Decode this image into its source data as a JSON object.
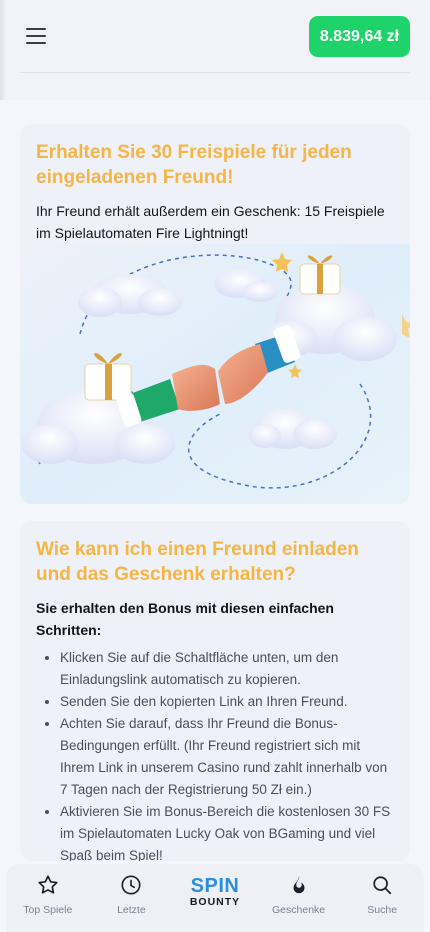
{
  "header": {
    "balance": "8.839,64 zł"
  },
  "invite_card": {
    "title": "Erhalten Sie 30 Freispiele für jeden eingeladenen Freund!",
    "subtitle": "Ihr Freund erhält außerdem ein Geschenk: 15 Freispiele im Spielautomaten Fire Lightningt!"
  },
  "howto_card": {
    "title": "Wie kann ich einen Freund einladen und das Geschenk erhalten?",
    "lead": "Sie erhalten den Bonus mit diesen einfachen Schritten:",
    "steps": [
      "Klicken Sie auf die Schaltfläche unten, um den Einladungslink automatisch zu kopieren.",
      "Senden Sie den kopierten Link an Ihren Freund.",
      "Achten Sie darauf, dass Ihr Freund die Bonus-Bedingungen erfüllt. (Ihr Freund registriert sich mit Ihrem Link in unserem Casino rund zahlt innerhalb von 7 Tagen nach der Registrierung 50 Zł ein.)",
      "Aktivieren Sie im Bonus-Bereich die kostenlosen 30 FS im Spielautomaten Lucky Oak von BGaming und viel Spaß beim Spiel!"
    ]
  },
  "bottom_nav": {
    "items": [
      {
        "label": "Top Spiele",
        "icon": "star-icon"
      },
      {
        "label": "Letzte",
        "icon": "clock-icon"
      },
      {
        "label": "",
        "icon": "spin-bounty-logo"
      },
      {
        "label": "Geschenke",
        "icon": "fire-icon"
      },
      {
        "label": "Suche",
        "icon": "search-icon"
      }
    ],
    "logo_top": "SPIN",
    "logo_bottom": "BOUNTY"
  },
  "colors": {
    "accent_orange": "#f6b545",
    "balance_green": "#1ed36a",
    "logo_blue": "#2a8fe0"
  }
}
